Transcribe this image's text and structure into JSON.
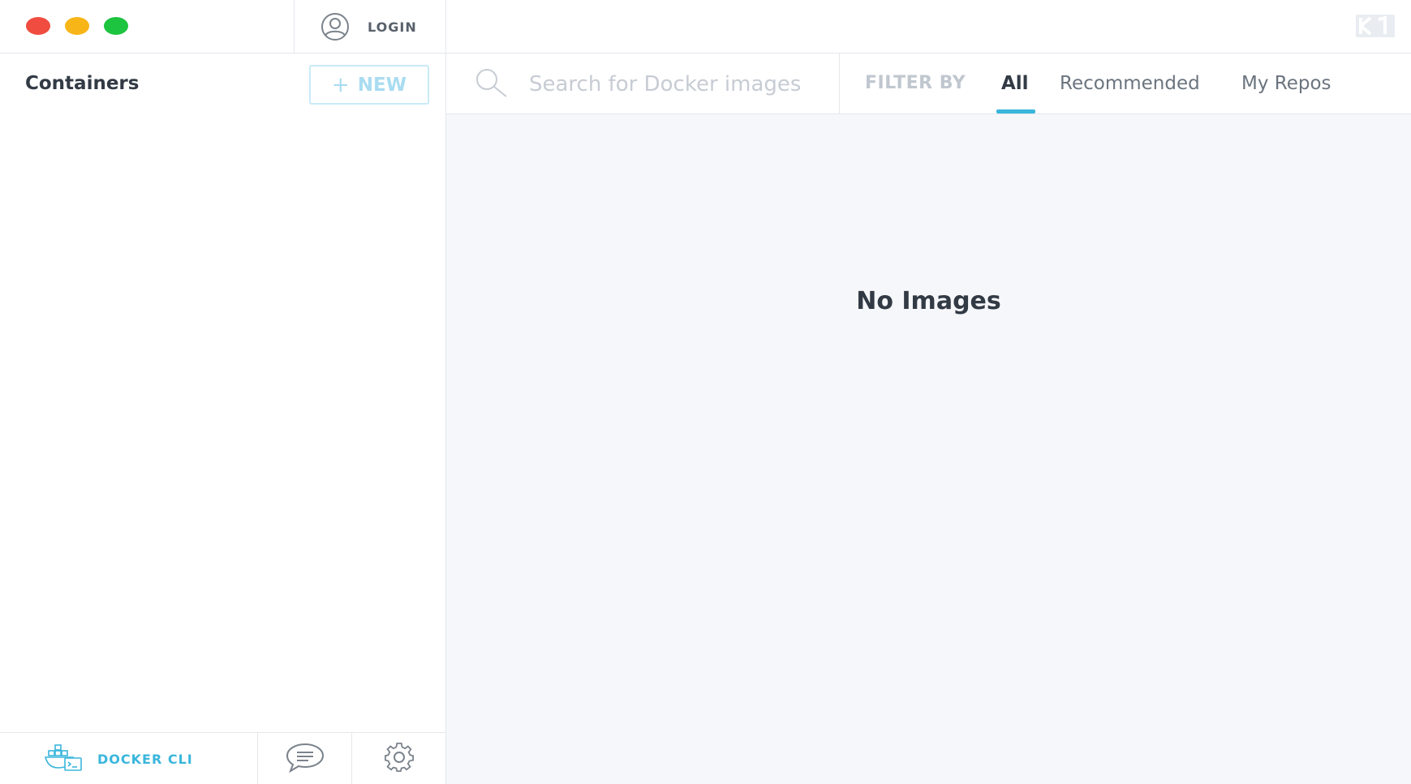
{
  "sidebar": {
    "login_label": "LOGIN",
    "title": "Containers",
    "new_button": {
      "plus": "+",
      "label": "NEW"
    },
    "footer": {
      "docker_cli_label": "DOCKER CLI"
    }
  },
  "search": {
    "placeholder": "Search for Docker images"
  },
  "filters": {
    "label": "FILTER BY",
    "tabs": [
      {
        "label": "All",
        "active": true
      },
      {
        "label": "Recommended",
        "active": false
      },
      {
        "label": "My Repos",
        "active": false
      }
    ]
  },
  "main": {
    "empty_message": "No Images"
  },
  "icons": {
    "user": "user-circle-icon",
    "search": "search-icon",
    "docker_cli": "docker-cli-icon",
    "feedback": "chat-bubble-icon",
    "settings": "gear-icon",
    "logo": "kitematic-logo-icon"
  },
  "colors": {
    "accent": "#3ab6dc",
    "close": "#f04c40",
    "minimize": "#f7b517",
    "maximize": "#1dc43f",
    "main_background": "#f6f7fa"
  }
}
